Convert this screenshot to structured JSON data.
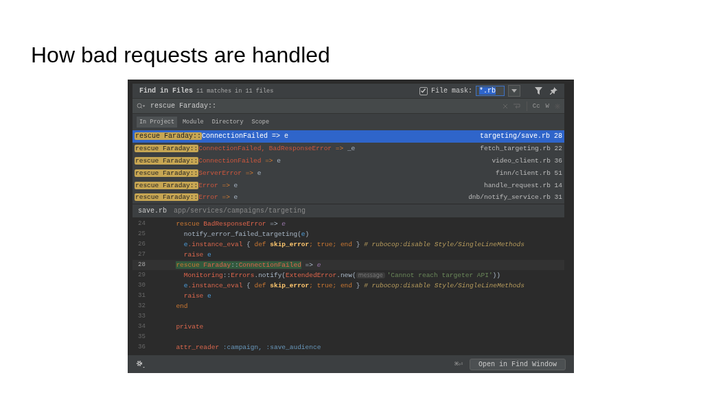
{
  "slide": {
    "title": "How bad requests are handled"
  },
  "find": {
    "title": "Find in Files",
    "match_count": "11 matches in 11 files",
    "file_mask": {
      "checked": true,
      "label": "File mask:",
      "value": "*.rb"
    },
    "query": "rescue Faraday::",
    "toggles": [
      "Cc",
      "W"
    ],
    "scopes": [
      {
        "label": "In Project",
        "selected": true
      },
      {
        "label": "Module",
        "selected": false
      },
      {
        "label": "Directory",
        "selected": false
      },
      {
        "label": "Scope",
        "selected": false
      }
    ],
    "results": [
      {
        "match": "rescue Faraday::",
        "tokens": [
          {
            "text": "ConnectionFailed",
            "kind": "const"
          },
          {
            "text": " => ",
            "kind": "op"
          },
          {
            "text": "e",
            "kind": "plain"
          }
        ],
        "file": "targeting/save.rb",
        "line": "28",
        "selected": true
      },
      {
        "match": "rescue Faraday::",
        "tokens": [
          {
            "text": "ConnectionFailed, BadResponseError",
            "kind": "const"
          },
          {
            "text": " => ",
            "kind": "op"
          },
          {
            "text": "_e",
            "kind": "plain"
          }
        ],
        "file": "fetch_targeting.rb",
        "line": "22",
        "selected": false
      },
      {
        "match": "rescue Faraday::",
        "tokens": [
          {
            "text": "ConnectionFailed",
            "kind": "const"
          },
          {
            "text": " => ",
            "kind": "op"
          },
          {
            "text": "e",
            "kind": "plain"
          }
        ],
        "file": "video_client.rb",
        "line": "36",
        "selected": false
      },
      {
        "match": "rescue Faraday::",
        "tokens": [
          {
            "text": "ServerError",
            "kind": "const"
          },
          {
            "text": " => ",
            "kind": "op"
          },
          {
            "text": "e",
            "kind": "plain"
          }
        ],
        "file": "finn/client.rb",
        "line": "51",
        "selected": false
      },
      {
        "match": "rescue Faraday::",
        "tokens": [
          {
            "text": "Error",
            "kind": "const"
          },
          {
            "text": " => ",
            "kind": "op"
          },
          {
            "text": "e",
            "kind": "plain"
          }
        ],
        "file": "handle_request.rb",
        "line": "14",
        "selected": false
      },
      {
        "match": "rescue Faraday::",
        "tokens": [
          {
            "text": "Error",
            "kind": "const"
          },
          {
            "text": " => ",
            "kind": "op"
          },
          {
            "text": "e",
            "kind": "plain"
          }
        ],
        "file": "dnb/notify_service.rb",
        "line": "31",
        "selected": false
      }
    ],
    "preview": {
      "file": "save.rb",
      "path": "app/services/campaigns/targeting",
      "lines": [
        {
          "number": "24",
          "current": false,
          "tokens": [
            {
              "text": "  rescue ",
              "kind": "kw"
            },
            {
              "text": "BadResponseError",
              "kind": "const"
            },
            {
              "text": " => ",
              "kind": "plain"
            },
            {
              "text": "e",
              "kind": "param"
            }
          ]
        },
        {
          "number": "25",
          "current": false,
          "tokens": [
            {
              "text": "    notify_error_failed_targeting(",
              "kind": "plain"
            },
            {
              "text": "e",
              "kind": "var"
            },
            {
              "text": ")",
              "kind": "plain"
            }
          ]
        },
        {
          "number": "26",
          "current": false,
          "tokens": [
            {
              "text": "    e",
              "kind": "var"
            },
            {
              "text": ".instance_eval",
              "kind": "method"
            },
            {
              "text": " { ",
              "kind": "plain"
            },
            {
              "text": "def",
              "kind": "kw"
            },
            {
              "text": " skip_error",
              "kind": "def"
            },
            {
              "text": "; ",
              "kind": "kw"
            },
            {
              "text": "true",
              "kind": "kw"
            },
            {
              "text": "; ",
              "kind": "kw"
            },
            {
              "text": "end",
              "kind": "kw"
            },
            {
              "text": " } ",
              "kind": "plain"
            },
            {
              "text": "# rubocop:disable Style/SingleLineMethods",
              "kind": "comment"
            }
          ]
        },
        {
          "number": "27",
          "current": false,
          "tokens": [
            {
              "text": "    raise ",
              "kind": "method"
            },
            {
              "text": "e",
              "kind": "var"
            }
          ]
        },
        {
          "number": "28",
          "current": true,
          "tokens": [
            {
              "text": "  rescue ",
              "kind": "kw",
              "hit": true
            },
            {
              "text": "Faraday",
              "kind": "const",
              "hit": true
            },
            {
              "text": "::",
              "kind": "plain",
              "hit": true
            },
            {
              "text": "ConnectionFailed",
              "kind": "const",
              "hit": true
            },
            {
              "text": " => ",
              "kind": "plain",
              "hit": false
            },
            {
              "text": "e",
              "kind": "param",
              "hit": false
            }
          ]
        },
        {
          "number": "29",
          "current": false,
          "tokens": [
            {
              "text": "    Monitoring",
              "kind": "const"
            },
            {
              "text": "::",
              "kind": "plain"
            },
            {
              "text": "Errors",
              "kind": "const"
            },
            {
              "text": ".notify(",
              "kind": "plain"
            },
            {
              "text": "ExtendedError",
              "kind": "const"
            },
            {
              "text": ".new(",
              "kind": "plain"
            },
            {
              "text": "message",
              "kind": "hint"
            },
            {
              "text": "'Cannot reach targeter API'",
              "kind": "string"
            },
            {
              "text": "))",
              "kind": "plain"
            }
          ]
        },
        {
          "number": "30",
          "current": false,
          "tokens": [
            {
              "text": "    e",
              "kind": "var"
            },
            {
              "text": ".instance_eval",
              "kind": "method"
            },
            {
              "text": " { ",
              "kind": "plain"
            },
            {
              "text": "def",
              "kind": "kw"
            },
            {
              "text": " skip_error",
              "kind": "def"
            },
            {
              "text": "; ",
              "kind": "kw"
            },
            {
              "text": "true",
              "kind": "kw"
            },
            {
              "text": "; ",
              "kind": "kw"
            },
            {
              "text": "end",
              "kind": "kw"
            },
            {
              "text": " } ",
              "kind": "plain"
            },
            {
              "text": "# rubocop:disable Style/SingleLineMethods",
              "kind": "comment"
            }
          ]
        },
        {
          "number": "31",
          "current": false,
          "tokens": [
            {
              "text": "    raise ",
              "kind": "method"
            },
            {
              "text": "e",
              "kind": "var"
            }
          ]
        },
        {
          "number": "32",
          "current": false,
          "tokens": [
            {
              "text": "  end",
              "kind": "kw"
            }
          ]
        },
        {
          "number": "33",
          "current": false
        },
        {
          "number": "34",
          "current": false,
          "tokens": [
            {
              "text": "  private",
              "kind": "method"
            }
          ]
        },
        {
          "number": "35",
          "current": false
        },
        {
          "number": "36",
          "current": false,
          "tokens": [
            {
              "text": "  attr_reader",
              "kind": "method"
            },
            {
              "text": " :campaign, :save_audience",
              "kind": "symbol"
            }
          ]
        }
      ]
    },
    "footer": {
      "shortcut": "⌘⏎",
      "button": "Open in Find Window"
    }
  }
}
